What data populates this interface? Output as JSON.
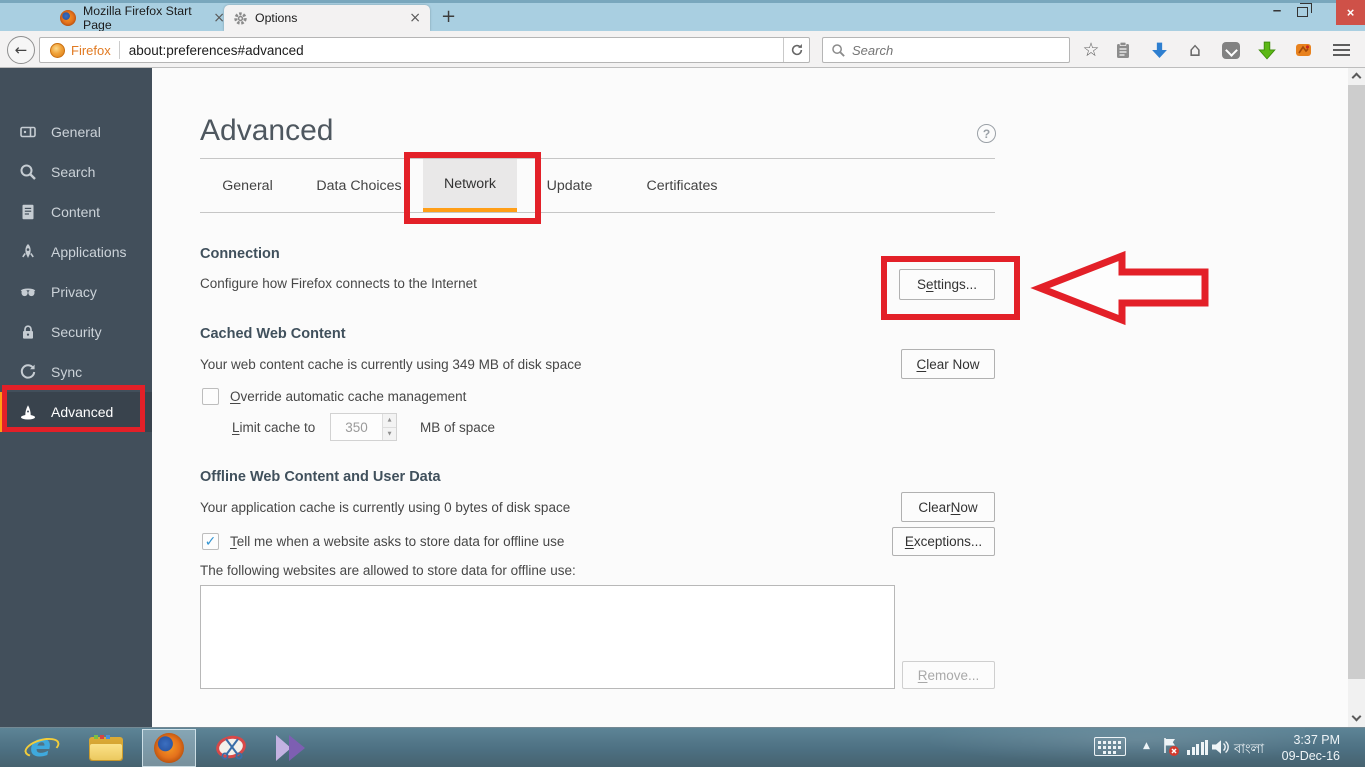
{
  "glyphs": {
    "tab_close": "×",
    "new_tab": "+",
    "minimize": "–",
    "close": "×",
    "back": "←",
    "star": "☆",
    "home": "⌂",
    "help": "?",
    "check": "✓",
    "spin_up": "▲",
    "spin_down": "▼",
    "tray_up": "▲",
    "ie_letter": "e"
  },
  "window": {
    "tabs": [
      {
        "title": "Mozilla Firefox Start Page"
      },
      {
        "title": "Options"
      }
    ]
  },
  "toolbar": {
    "identity_label": "Firefox",
    "url": "about:preferences#advanced",
    "search_placeholder": "Search"
  },
  "sidebar": {
    "items": [
      {
        "label": "General"
      },
      {
        "label": "Search"
      },
      {
        "label": "Content"
      },
      {
        "label": "Applications"
      },
      {
        "label": "Privacy"
      },
      {
        "label": "Security"
      },
      {
        "label": "Sync"
      },
      {
        "label": "Advanced"
      }
    ]
  },
  "main": {
    "title": "Advanced",
    "tabs": [
      "General",
      "Data Choices",
      "Network",
      "Update",
      "Certificates"
    ],
    "connection": {
      "heading": "Connection",
      "description": "Configure how Firefox connects to the Internet",
      "settings_button": {
        "pre": "S",
        "key": "e",
        "post": "ttings..."
      }
    },
    "cache": {
      "heading": "Cached Web Content",
      "status": "Your web content cache is currently using 349 MB of disk space",
      "clear_button": {
        "pre": "",
        "key": "C",
        "post": "lear Now"
      },
      "override_label": {
        "pre": "",
        "key": "O",
        "post": "verride automatic cache management"
      },
      "limit_label": {
        "pre": "",
        "key": "L",
        "post": "imit cache to"
      },
      "limit_value": "350",
      "limit_suffix": "MB of space"
    },
    "offline": {
      "heading": "Offline Web Content and User Data",
      "status": "Your application cache is currently using 0 bytes of disk space",
      "clear_button": {
        "pre": "Clear ",
        "key": "N",
        "post": "ow"
      },
      "tell_label": {
        "pre": "",
        "key": "T",
        "post": "ell me when a website asks to store data for offline use"
      },
      "exceptions_button": {
        "pre": "",
        "key": "E",
        "post": "xceptions..."
      },
      "list_caption": "The following websites are allowed to store data for offline use:",
      "remove_button": {
        "pre": "",
        "key": "R",
        "post": "emove..."
      }
    }
  },
  "taskbar": {
    "language": "বাংলা",
    "time": "3:37 PM",
    "date": "09-Dec-16"
  },
  "colors": {
    "accent_orange": "#ff9e17",
    "annotation_red": "#e32028",
    "sidebar_bg": "#424f5b",
    "tab_bar_blue": "#a9cfe1",
    "close_button_red": "#cf5148",
    "check_blue": "#3596d3"
  }
}
